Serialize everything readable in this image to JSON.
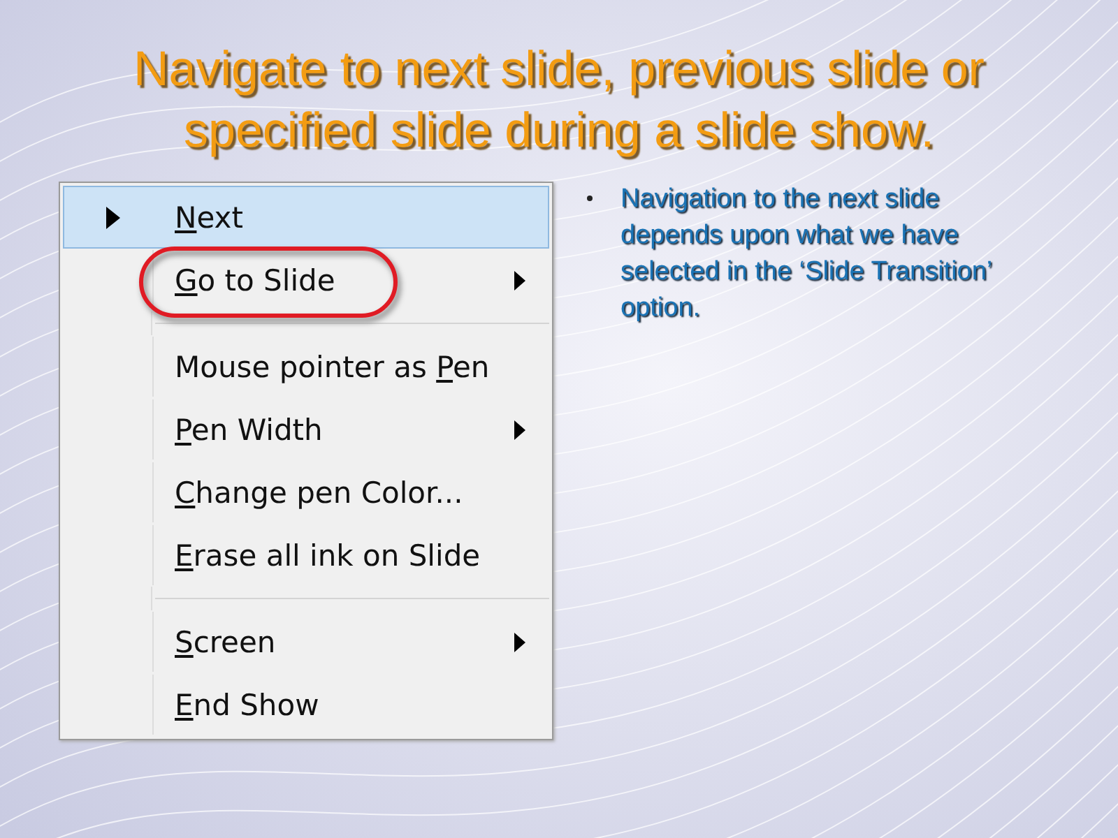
{
  "title": "Navigate to next slide, previous slide or specified slide during a slide show.",
  "menu": {
    "items": [
      {
        "kind": "item",
        "key": "N",
        "after": "ext",
        "selected": true,
        "current": true,
        "submenu": false,
        "circled": false
      },
      {
        "kind": "item",
        "key": "G",
        "after": "o to Slide",
        "selected": false,
        "current": false,
        "submenu": true,
        "circled": true
      },
      {
        "kind": "separator"
      },
      {
        "kind": "item",
        "before": "Mouse pointer as ",
        "key": "P",
        "after": "en",
        "selected": false,
        "current": false,
        "submenu": false,
        "circled": false
      },
      {
        "kind": "item",
        "key": "P",
        "after": "en Width",
        "selected": false,
        "current": false,
        "submenu": true,
        "circled": false
      },
      {
        "kind": "item",
        "key": "C",
        "after": "hange pen Color...",
        "selected": false,
        "current": false,
        "submenu": false,
        "circled": false
      },
      {
        "kind": "item",
        "key": "E",
        "after": "rase all ink on Slide",
        "selected": false,
        "current": false,
        "submenu": false,
        "circled": false
      },
      {
        "kind": "separator"
      },
      {
        "kind": "item",
        "key": "S",
        "after": "creen",
        "selected": false,
        "current": false,
        "submenu": true,
        "circled": false
      },
      {
        "kind": "item",
        "key": "E",
        "after": "nd Show",
        "selected": false,
        "current": false,
        "submenu": false,
        "circled": false
      }
    ]
  },
  "bullets": [
    "Navigation to the next slide depends upon what we have selected in the ‘Slide Transition’ option."
  ]
}
